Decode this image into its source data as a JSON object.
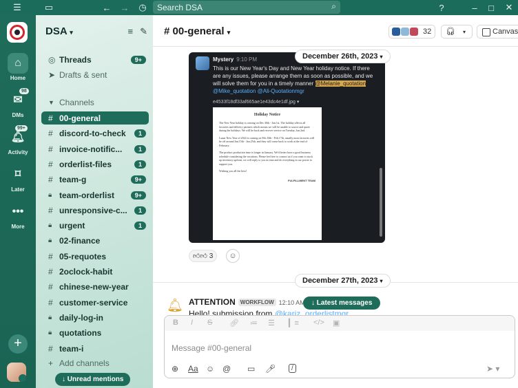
{
  "search": {
    "placeholder": "Search DSA"
  },
  "rail": {
    "items": [
      {
        "label": "Home",
        "badge": ""
      },
      {
        "label": "DMs",
        "badge": "98"
      },
      {
        "label": "Activity",
        "badge": "99+"
      },
      {
        "label": "Later",
        "badge": ""
      },
      {
        "label": "More",
        "badge": ""
      }
    ]
  },
  "sidebar": {
    "workspace": "DSA",
    "top": [
      {
        "label": "Threads",
        "badge": "9+"
      },
      {
        "label": "Drafts & sent",
        "badge": ""
      }
    ],
    "section": "Channels",
    "channels": [
      {
        "label": "00-general",
        "badge": "",
        "lock": false
      },
      {
        "label": "discord-to-check",
        "badge": "1",
        "lock": false
      },
      {
        "label": "invoice-notific...",
        "badge": "1",
        "lock": false
      },
      {
        "label": "orderlist-files",
        "badge": "1",
        "lock": false
      },
      {
        "label": "team-g",
        "badge": "9+",
        "lock": false
      },
      {
        "label": "team-orderlist",
        "badge": "9+",
        "lock": true
      },
      {
        "label": "unresponsive-c...",
        "badge": "1",
        "lock": false
      },
      {
        "label": "urgent",
        "badge": "1",
        "lock": true
      },
      {
        "label": "02-finance",
        "badge": "",
        "lock": true
      },
      {
        "label": "05-requotes",
        "badge": "",
        "lock": false
      },
      {
        "label": "2oclock-habit",
        "badge": "",
        "lock": false
      },
      {
        "label": "chinese-new-year",
        "badge": "",
        "lock": false
      },
      {
        "label": "customer-service",
        "badge": "",
        "lock": false
      },
      {
        "label": "daily-log-in",
        "badge": "",
        "lock": true
      },
      {
        "label": "quotations",
        "badge": "",
        "lock": true
      },
      {
        "label": "team-i",
        "badge": "",
        "lock": false
      }
    ],
    "add_channels": "Add channels",
    "unread": "Unread mentions"
  },
  "header": {
    "channel": "# 00-general",
    "member_count": "32",
    "canvas": "Canvas"
  },
  "messages": {
    "date1": "December 26th, 2023",
    "att_author": "Mystery",
    "att_time": "9:10 PM",
    "att_text": "This is our New Year's Day and New Year holiday notice. If there are any issues, please arrange them as soon as possible, and we will solve them for you in a timely manner",
    "att_mention1": "@Melanie_quotation",
    "att_mention2": "@Mike_quotation",
    "att_mention3": "@Ali-Quotationmgr",
    "att_file": "e4533f18df33af665ae1e43dc4e1df.jpg",
    "notice": {
      "title": "Holiday Notice",
      "p1": "The New Year holiday is coming on Dec.30th - Jan.1st. The holiday affects all factories and delivery partners which means we will be unable to source and quote during the holidays. We will be back and recover service on Tuesday, Jan.2nd.",
      "p2": "Lunar New Year of 2024 is coming on Feb.10th - Feb.17th, usually most factories will be off around Jan.15th - Jan.25th, and they will come back to work at the end of February.",
      "p3": "The product production time is longer in January. We'd better have a good business schedule considering the vacations. Please feel free to contact us if you want to stock up inventory upfront, we will reply to you in time and do everything in our power to support you.",
      "p4": "Wishing you all the best!",
      "sign": "FULFILLMENT TEAM"
    },
    "reaction_count": "3",
    "date2": "December 27th, 2023",
    "wf_name": "ATTENTION",
    "wf_tag": "WORKFLOW",
    "wf_time": "12:10 AM",
    "wf_body": "Hello! submission from",
    "wf_mention": "@kariz_orderlistmgr",
    "latest": "↓ Latest messages"
  },
  "composer": {
    "placeholder": "Message #00-general"
  },
  "colors": {
    "brand": "#1e6c5a",
    "sidebar_bg": "#cfe8df"
  }
}
